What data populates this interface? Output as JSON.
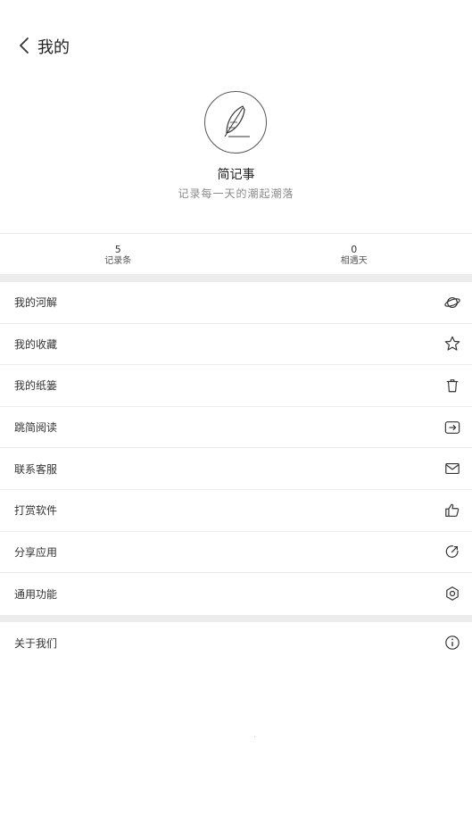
{
  "header": {
    "title": "我的"
  },
  "profile": {
    "app_name": "简记事",
    "slogan": "记录每一天的潮起潮落"
  },
  "stats": [
    {
      "value": "5",
      "label": "记录条"
    },
    {
      "value": "0",
      "label": "相遇天"
    }
  ],
  "menu_group1": [
    {
      "label": "我的河解",
      "icon": "planet-icon"
    },
    {
      "label": "我的收藏",
      "icon": "star-icon"
    },
    {
      "label": "我的纸篓",
      "icon": "trash-icon"
    },
    {
      "label": "跳简阅读",
      "icon": "export-icon"
    },
    {
      "label": "联系客服",
      "icon": "mail-icon"
    },
    {
      "label": "打赏软件",
      "icon": "thumbs-up-icon"
    },
    {
      "label": "分享应用",
      "icon": "share-icon"
    },
    {
      "label": "通用功能",
      "icon": "gear-icon"
    }
  ],
  "menu_group2": [
    {
      "label": "关于我们",
      "icon": "info-icon"
    }
  ]
}
